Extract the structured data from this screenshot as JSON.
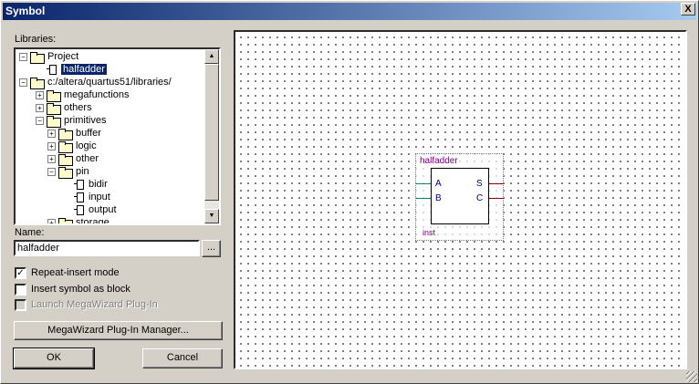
{
  "window": {
    "title": "Symbol",
    "close_glyph": "X"
  },
  "libraries": {
    "label": "Libraries:",
    "tree": [
      {
        "label": "Project",
        "expander": "−",
        "type": "folder",
        "indent": 0
      },
      {
        "label": "halfadder",
        "expander": "",
        "type": "symbol",
        "indent": 1,
        "selected": true
      },
      {
        "label": "c:/altera/quartus51/libraries/",
        "expander": "−",
        "type": "folder",
        "indent": 0
      },
      {
        "label": "megafunctions",
        "expander": "+",
        "type": "folder",
        "indent": 1
      },
      {
        "label": "others",
        "expander": "+",
        "type": "folder",
        "indent": 1
      },
      {
        "label": "primitives",
        "expander": "−",
        "type": "folder",
        "indent": 1
      },
      {
        "label": "buffer",
        "expander": "+",
        "type": "folder",
        "indent": 2
      },
      {
        "label": "logic",
        "expander": "+",
        "type": "folder",
        "indent": 2
      },
      {
        "label": "other",
        "expander": "+",
        "type": "folder",
        "indent": 2
      },
      {
        "label": "pin",
        "expander": "−",
        "type": "folder",
        "indent": 2
      },
      {
        "label": "bidir",
        "expander": "",
        "type": "symbol",
        "indent": 3
      },
      {
        "label": "input",
        "expander": "",
        "type": "symbol",
        "indent": 3
      },
      {
        "label": "output",
        "expander": "",
        "type": "symbol",
        "indent": 3
      },
      {
        "label": "storage",
        "expander": "+",
        "type": "folder",
        "indent": 2
      }
    ]
  },
  "name": {
    "label": "Name:",
    "value": "halfadder",
    "browse_label": "..."
  },
  "options": {
    "repeat_insert": {
      "label": "Repeat-insert mode",
      "checked": true,
      "check_glyph": "✓"
    },
    "insert_block": {
      "label": "Insert symbol as block",
      "checked": false
    },
    "megawizard": {
      "label": "Launch MegaWizard Plug-In",
      "checked": false,
      "disabled": true
    }
  },
  "buttons": {
    "megawizard_manager": "MegaWizard Plug-In Manager...",
    "ok": "OK",
    "cancel": "Cancel"
  },
  "preview": {
    "symbol_name": "halfadder",
    "instance": "inst",
    "inputs": [
      "A",
      "B"
    ],
    "outputs": [
      "S",
      "C"
    ]
  },
  "colors": {
    "title_bar": "#0a246a",
    "selection": "#0a246a",
    "symbol_text": "#800080",
    "port_text": "#000080",
    "input_wire": "#008080",
    "output_wire": "#800000"
  }
}
